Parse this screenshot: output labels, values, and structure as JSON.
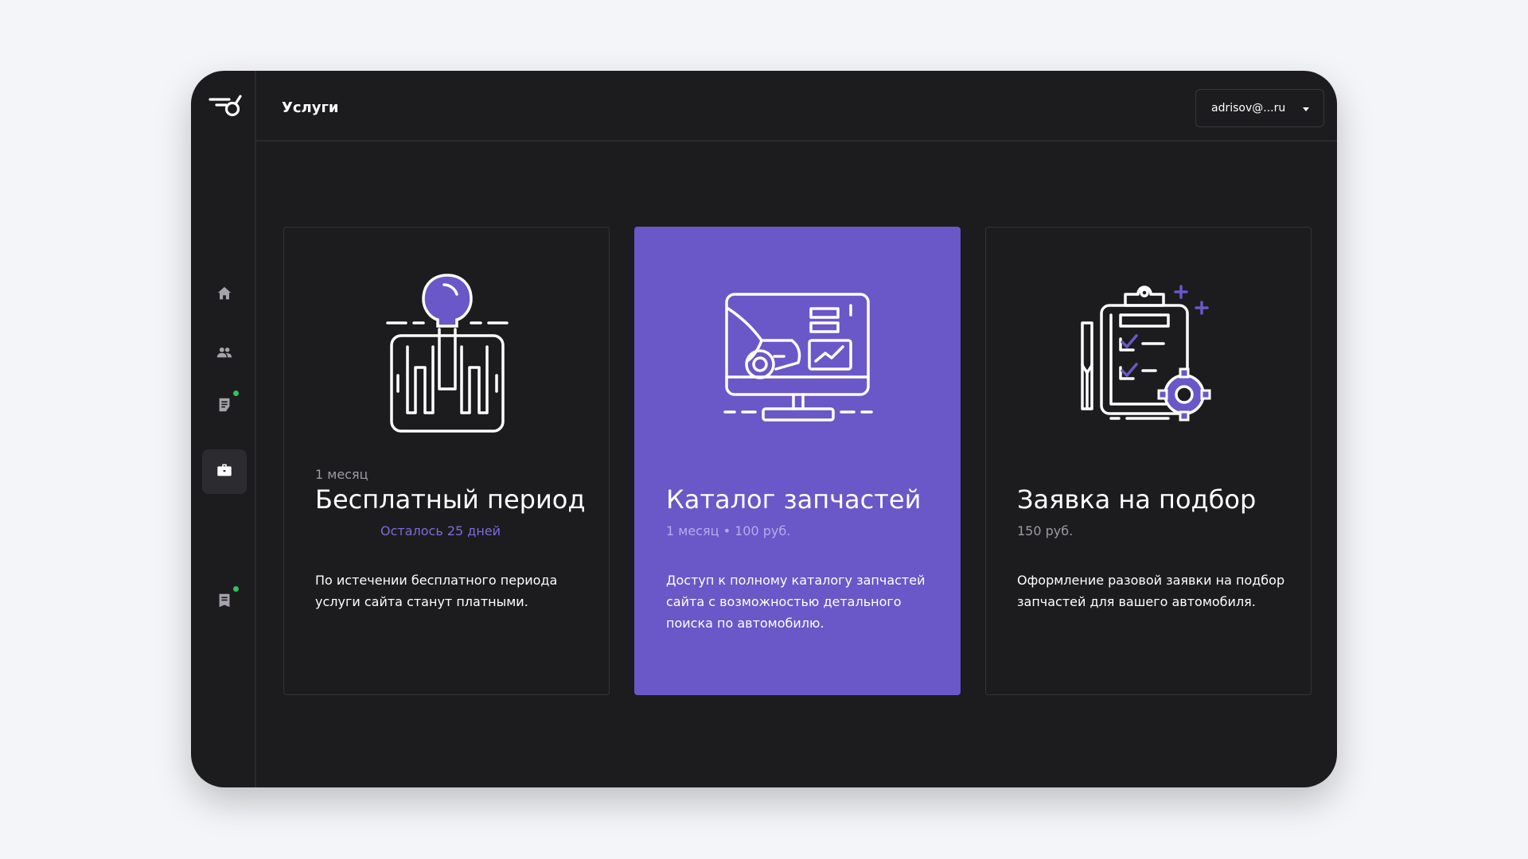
{
  "app": {
    "logo_icon": "wrench-logo-icon"
  },
  "header": {
    "title": "Услуги",
    "user": "adrisov@...ru"
  },
  "sidebar": {
    "items": [
      {
        "icon": "home-icon",
        "active": false,
        "badge": false
      },
      {
        "icon": "users-icon",
        "active": false,
        "badge": false
      },
      {
        "icon": "document-icon",
        "active": false,
        "badge": true
      },
      {
        "icon": "briefcase-icon",
        "active": true,
        "badge": false
      },
      {
        "icon": "receipt-icon",
        "active": false,
        "badge": true
      }
    ]
  },
  "cards": [
    {
      "period": "1 месяц",
      "title": "Бесплатный период",
      "subtitle": "Осталось 25 дней",
      "description": "По истечении бесплатного периода услуги сайта станут платными.",
      "icon": "gear-shifter-icon"
    },
    {
      "period": "",
      "title": "Каталог запчастей",
      "subtitle": "1 месяц • 100 руб.",
      "description": "Доступ к полному каталогу запчастей сайта с возможностью детального поиска по автомобилю.",
      "icon": "monitor-catalog-icon"
    },
    {
      "period": "",
      "title": "Заявка на подбор",
      "subtitle": "150 руб.",
      "description": "Оформление разовой заявки на подбор запчастей для вашего автомобиля.",
      "icon": "clipboard-checklist-icon"
    }
  ],
  "colors": {
    "accent": "#6a57c8",
    "background": "#1c1c1e",
    "badge": "#2fc35a",
    "accent_text": "#7d6bdb"
  }
}
